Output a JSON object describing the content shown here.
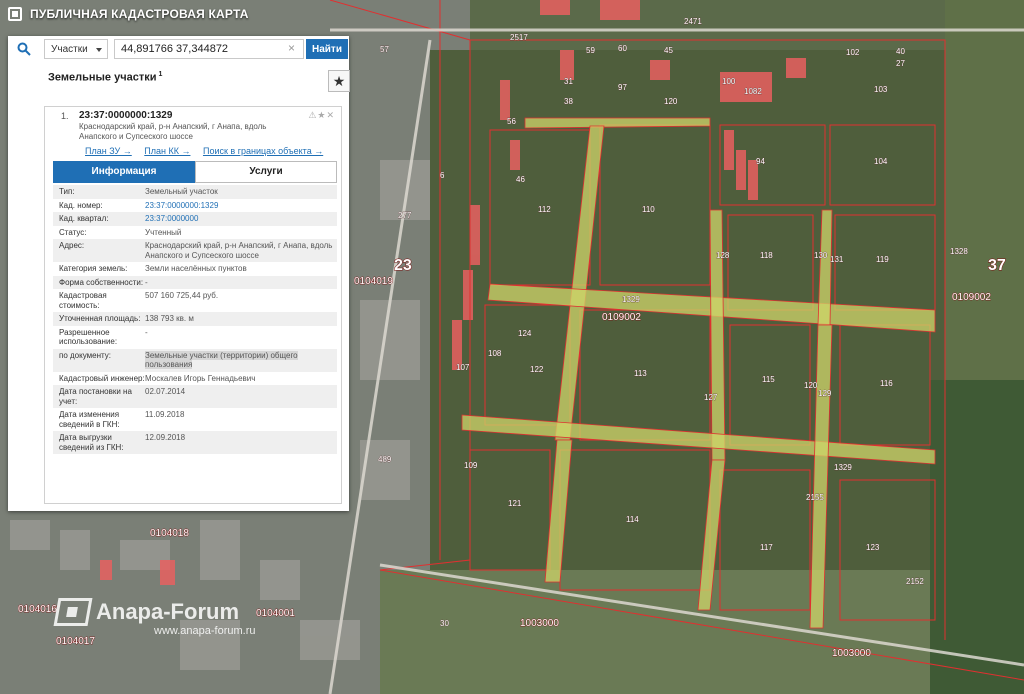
{
  "app": {
    "title": "ПУБЛИЧНАЯ КАДАСТРОВАЯ КАРТА"
  },
  "search": {
    "type_label": "Участки",
    "query": "44,891766 37,344872",
    "clear_glyph": "×",
    "find_label": "Найти"
  },
  "panel": {
    "title": "Земельные участки",
    "count_sup": "1",
    "favorite_glyph": "★"
  },
  "card": {
    "index": "1.",
    "number": "23:37:0000000:1329",
    "address": "Краснодарский край, р-н Анапский, г Анапа, вдоль Анапского и Супсеского шоссе",
    "tools": "⚠★✕",
    "links": [
      "План ЗУ →",
      "План КК →",
      "Поиск в границах объекта →"
    ]
  },
  "tabs": {
    "info": "Информация",
    "services": "Услуги"
  },
  "attributes": [
    {
      "k": "Тип:",
      "v": "Земельный участок"
    },
    {
      "k": "Кад. номер:",
      "v": "23:37:0000000:1329"
    },
    {
      "k": "Кад. квартал:",
      "v": "23:37:0000000"
    },
    {
      "k": "Статус:",
      "v": "Учтенный"
    },
    {
      "k": "Адрес:",
      "v": "Краснодарский край, р-н Анапский, г Анапа, вдоль Анапского и Супсеского шоссе"
    },
    {
      "k": "Категория земель:",
      "v": "Земли населённых пунктов"
    },
    {
      "k": "Форма собственности:",
      "v": "-"
    },
    {
      "k": "Кадастровая стоимость:",
      "v": "507 160 725,44 руб."
    },
    {
      "k": "Уточненная площадь:",
      "v": "138 793 кв. м"
    },
    {
      "k": "Разрешенное использование:",
      "v": "-"
    },
    {
      "k": "по документу:",
      "v": "Земельные участки (территории) общего пользования"
    },
    {
      "k": "Кадастровый инженер:",
      "v": "Москалев Игорь Геннадьевич"
    },
    {
      "k": "Дата постановки на учет:",
      "v": "02.07.2014"
    },
    {
      "k": "Дата изменения сведений в ГКН:",
      "v": "11.09.2018"
    },
    {
      "k": "Дата выгрузки сведений из ГКН:",
      "v": "12.09.2018"
    }
  ],
  "map": {
    "parcel_labels": [
      "2517",
      "57",
      "59",
      "60",
      "45",
      "102",
      "40",
      "27",
      "31",
      "97",
      "100",
      "1082",
      "103",
      "38",
      "120",
      "56",
      "110",
      "94",
      "104",
      "46",
      "112",
      "6",
      "277",
      "128",
      "118",
      "130",
      "131",
      "119",
      "1328",
      "23",
      "37",
      "0104019",
      "0109002",
      "1329",
      "0109002",
      "124",
      "108",
      "122",
      "113",
      "115",
      "120",
      "116",
      "107",
      "127",
      "129",
      "1329",
      "109",
      "121",
      "114",
      "2155",
      "117",
      "123",
      "2152",
      "0104018",
      "0104016",
      "0104017",
      "0104001",
      "30",
      "1003000",
      "1003000",
      "489",
      "2471"
    ]
  },
  "watermark": {
    "name": "Anapa-Forum",
    "url": "www.anapa-forum.ru"
  },
  "colors": {
    "accent": "#1f6fb5",
    "parcel_border": "#e03030",
    "road_fill": "#cfd56a"
  }
}
